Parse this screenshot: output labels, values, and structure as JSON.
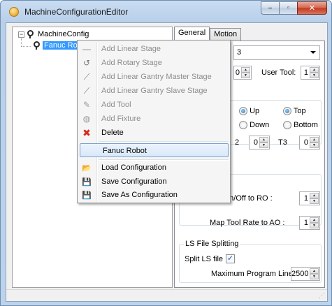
{
  "window": {
    "title": "MachineConfigurationEditor",
    "controls": {
      "minimize": "–",
      "maximize": "▫",
      "close": "✕"
    }
  },
  "tree": {
    "root": {
      "expander": "−",
      "label": "MachineConfig",
      "icon": "robot-node-icon"
    },
    "child": {
      "label": "Fanuc Ro",
      "icon": "robot-node-icon",
      "selected": true
    }
  },
  "tabs": [
    {
      "label": "General",
      "active": true
    },
    {
      "label": "Motion",
      "active": false
    }
  ],
  "general": {
    "dropdown_value": "3",
    "spin1_value": "0",
    "user_tool_label": "User Tool:",
    "user_tool_value": "1",
    "up_label": "Up",
    "down_label": "Down",
    "top_label": "Top",
    "bottom_label": "Bottom",
    "t2_label": "2",
    "t2_value": "0",
    "t3_label": "T3",
    "t3_value": "0",
    "tool_onoff_label": "ol On/Off to RO :",
    "tool_onoff_value": "1",
    "tool_rate_label": "Map Tool Rate to AO :",
    "tool_rate_value": "1",
    "ls_group_title": "LS File Splitting",
    "split_ls_label": "Split LS file",
    "split_ls_checked": "✓",
    "max_lines_label": "Maximum Program Lines:",
    "max_lines_value": "2500"
  },
  "context_menu": {
    "items": [
      {
        "label": "Add Linear Stage",
        "icon": "linear-stage-icon",
        "glyph": "—",
        "disabled": true
      },
      {
        "label": "Add Rotary Stage",
        "icon": "rotary-stage-icon",
        "glyph": "↺",
        "disabled": true
      },
      {
        "label": "Add Linear Gantry Master Stage",
        "icon": "gantry-master-icon",
        "glyph": "⟋",
        "disabled": true
      },
      {
        "label": "Add Linear Gantry Slave Stage",
        "icon": "gantry-slave-icon",
        "glyph": "⟋",
        "disabled": true
      },
      {
        "label": "Add Tool",
        "icon": "tool-icon",
        "glyph": "✎",
        "disabled": true
      },
      {
        "label": "Add Fixture",
        "icon": "fixture-icon",
        "glyph": "◍",
        "disabled": true
      },
      {
        "label": "Delete",
        "icon": "delete-icon",
        "glyph": "✖",
        "disabled": false
      },
      {
        "label": "Fanuc Robot",
        "icon": "",
        "glyph": "",
        "disabled": false,
        "hover": true
      },
      {
        "label": "Load Configuration",
        "icon": "folder-open-icon",
        "glyph": "📂",
        "disabled": false
      },
      {
        "label": "Save Configuration",
        "icon": "save-icon",
        "glyph": "💾",
        "disabled": false
      },
      {
        "label": "Save As Configuration",
        "icon": "save-as-icon",
        "glyph": "💾",
        "disabled": false
      }
    ]
  },
  "colors": {
    "selection": "#3399ff",
    "delete_red": "#d42a1f",
    "hover_border": "#7da2ce"
  }
}
